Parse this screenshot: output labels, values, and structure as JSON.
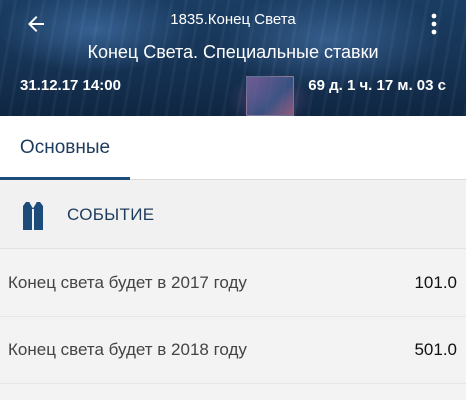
{
  "header": {
    "title": "1835.Конец Света",
    "subtitle": "Конец Света. Специальные ставки",
    "date": "31.12.17 14:00",
    "countdown": "69 д. 1 ч. 17 м. 03 с",
    "back_icon": "arrow-left-icon",
    "menu_icon": "more-vert-icon"
  },
  "tabs": [
    {
      "label": "Основные",
      "active": true
    }
  ],
  "section": {
    "label": "СОБЫТИЕ",
    "icon": "jersey-icon"
  },
  "bets": [
    {
      "name": "Конец света будет в 2017 году",
      "odds": "101.0"
    },
    {
      "name": "Конец света будет в 2018 году",
      "odds": "501.0"
    }
  ],
  "colors": {
    "header_bg": "#163456",
    "accent": "#1d4c7a",
    "text_primary": "#1d3c5c"
  }
}
